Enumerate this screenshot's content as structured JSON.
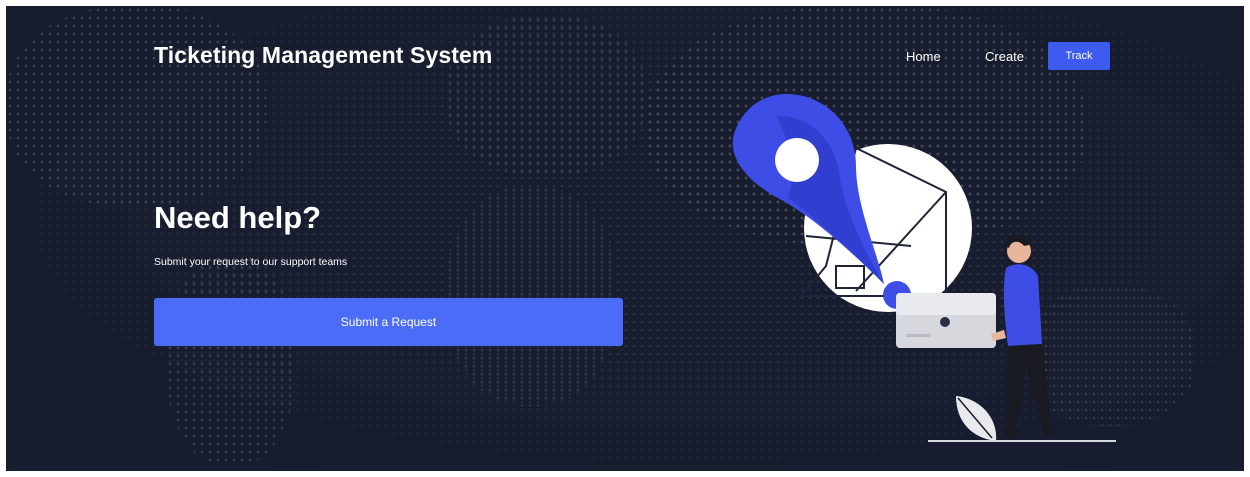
{
  "header": {
    "brand": "Ticketing Management System",
    "nav": {
      "home": "Home",
      "create": "Create",
      "track": "Track"
    }
  },
  "hero": {
    "title": "Need help?",
    "subtitle": "Submit your request to our support teams",
    "cta_label": "Submit a Request"
  },
  "colors": {
    "background": "#171c2e",
    "accent": "#3d5af1",
    "cta": "#4a6cf7"
  },
  "illustration": {
    "icons": [
      "map-pin-icon",
      "folder-icon",
      "leaf-icon"
    ]
  }
}
